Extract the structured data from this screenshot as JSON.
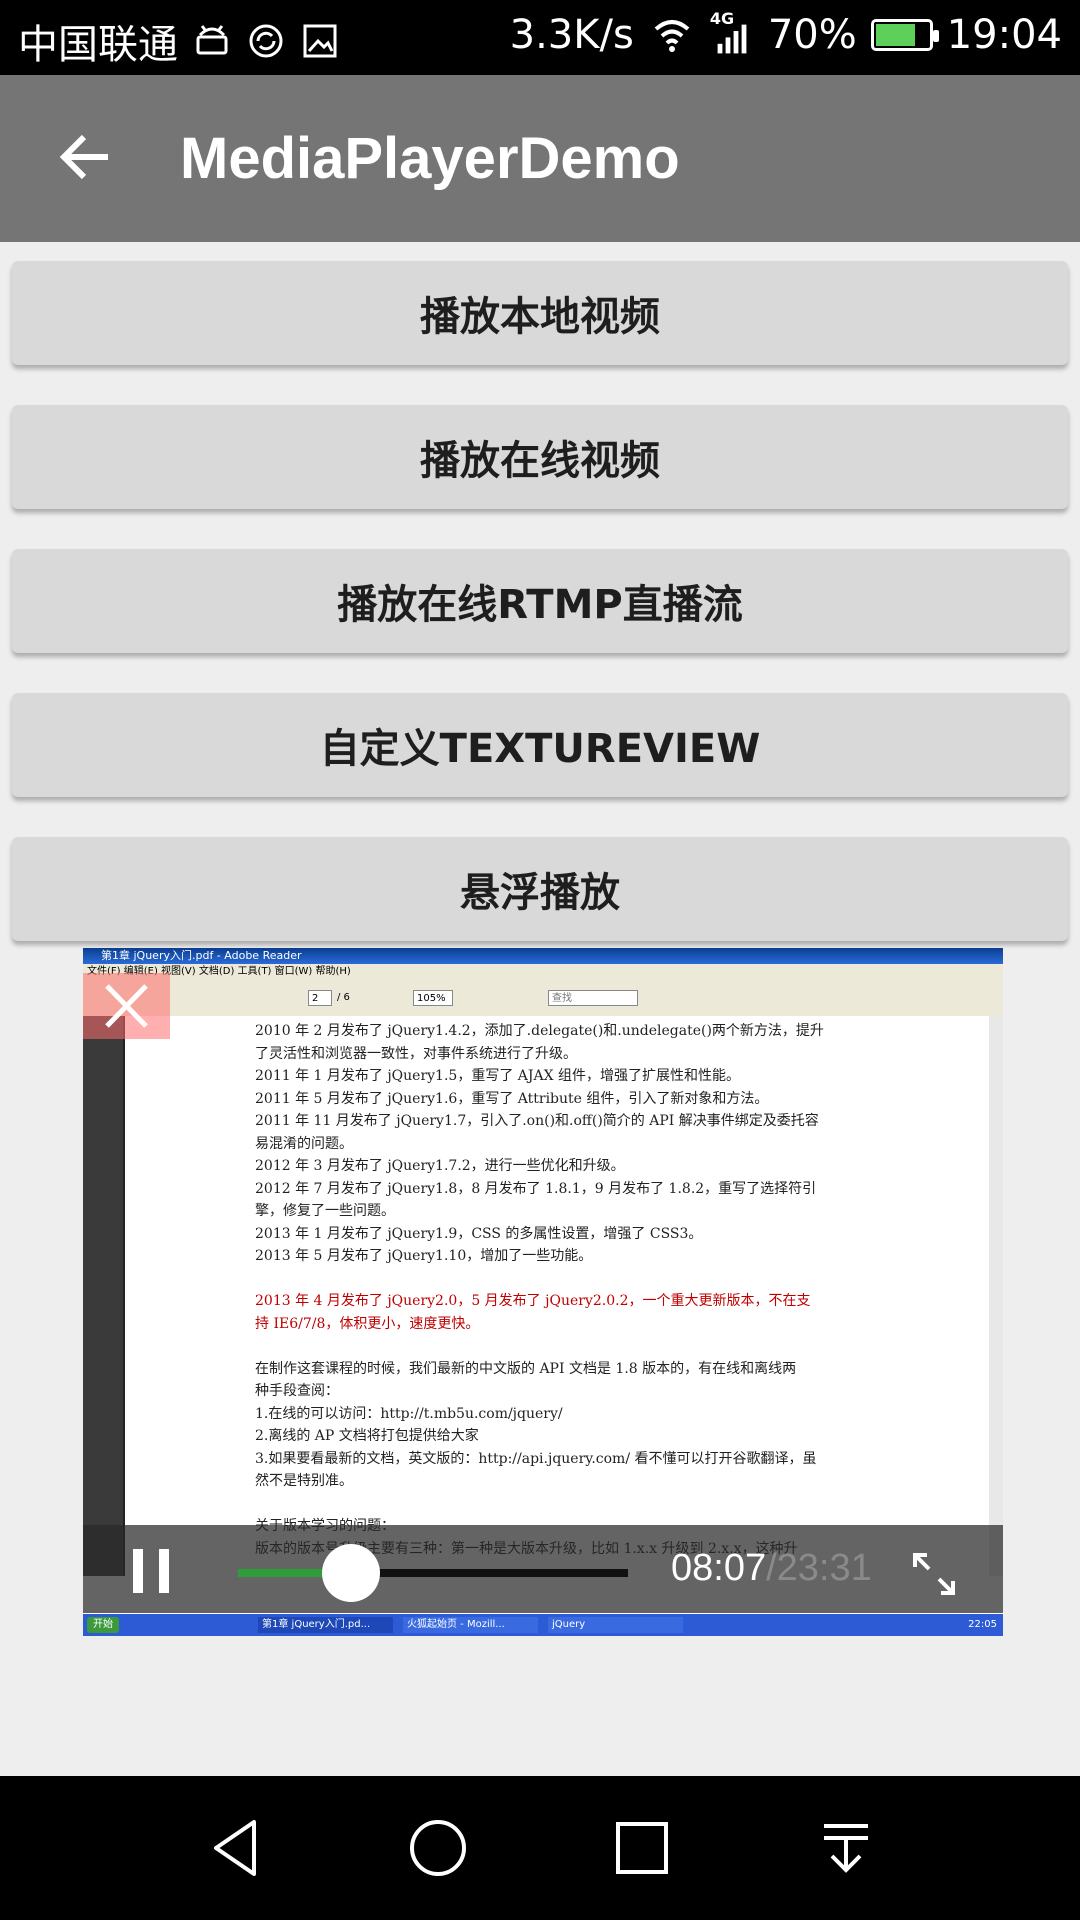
{
  "status_bar": {
    "carrier": "中国联通",
    "network_speed": "3.3K/s",
    "network_type": "4G",
    "battery": "70%",
    "battery_level": 0.7,
    "time": "19:04",
    "icons": [
      "android-icon",
      "sync-icon",
      "image-icon",
      "wifi-icon",
      "signal-icon",
      "battery-icon"
    ]
  },
  "app_bar": {
    "title": "MediaPlayerDemo",
    "back_icon": "arrow-back-icon"
  },
  "buttons": [
    {
      "label": "播放本地视频"
    },
    {
      "label": "播放在线视频"
    },
    {
      "label": "播放在线RTMP直播流"
    },
    {
      "label": "自定义TEXTUREVIEW"
    },
    {
      "label": "悬浮播放"
    }
  ],
  "floating_video": {
    "frame": {
      "window_title": "第1章 jQuery入门.pdf - Adobe Reader",
      "menu": "文件(F)  编辑(E)  视图(V)  文档(D)  工具(T)  窗口(W)  帮助(H)",
      "page_field": "2",
      "page_total": "/ 6",
      "zoom": "105%",
      "search_placeholder": "查找",
      "lines": [
        {
          "text": "2010 年 2 月发布了 jQuery1.4.2，添加了.delegate()和.undelegate()两个新方法，提升",
          "style": ""
        },
        {
          "text": "了灵活性和浏览器一致性，对事件系统进行了升级。",
          "style": ""
        },
        {
          "text": "2011 年 1 月发布了 jQuery1.5，重写了 AJAX 组件，增强了扩展性和性能。",
          "style": ""
        },
        {
          "text": "2011 年 5 月发布了 jQuery1.6，重写了 Attribute 组件，引入了新对象和方法。",
          "style": ""
        },
        {
          "text": "2011 年 11 月发布了 jQuery1.7，引入了.on()和.off()简介的 API 解决事件绑定及委托容",
          "style": ""
        },
        {
          "text": "易混淆的问题。",
          "style": ""
        },
        {
          "text": "2012 年 3 月发布了 jQuery1.7.2，进行一些优化和升级。",
          "style": ""
        },
        {
          "text": "2012 年 7 月发布了 jQuery1.8，8 月发布了 1.8.1，9 月发布了 1.8.2，重写了选择符引",
          "style": ""
        },
        {
          "text": "擎，修复了一些问题。",
          "style": ""
        },
        {
          "text": "2013 年 1 月发布了 jQuery1.9，CSS 的多属性设置，增强了 CSS3。",
          "style": ""
        },
        {
          "text": "2013 年 5 月发布了 jQuery1.10，增加了一些功能。",
          "style": ""
        },
        {
          "text": "",
          "style": ""
        },
        {
          "text": "2013 年 4 月发布了 jQuery2.0，5 月发布了 jQuery2.0.2，一个重大更新版本，不在支",
          "style": "red"
        },
        {
          "text": "持 IE6/7/8，体积更小，速度更快。",
          "style": "red"
        },
        {
          "text": "",
          "style": ""
        },
        {
          "text": "在制作这套课程的时候，我们最新的中文版的 API 文档是 1.8 版本的，有在线和离线两",
          "style": ""
        },
        {
          "text": "种手段查阅：",
          "style": ""
        },
        {
          "text": "1.在线的可以访问：http://t.mb5u.com/jquery/",
          "style": ""
        },
        {
          "text": "2.离线的 AP 文档将打包提供给大家",
          "style": ""
        },
        {
          "text": "3.如果要看最新的文档，英文版的：http://api.jquery.com/ 看不懂可以打开谷歌翻译，虽",
          "style": ""
        },
        {
          "text": "然不是特别准。",
          "style": ""
        },
        {
          "text": "",
          "style": ""
        },
        {
          "text": "关于版本学习的问题：",
          "style": ""
        },
        {
          "text": "版本的版本号升级主要有三种：第一种是大版本升级，比如 1.x.x 升级到 2.x.x，这种升",
          "style": ""
        }
      ],
      "taskbar_start": "开始",
      "taskbar_items": [
        "第1章 jQuery入门.pd...",
        "火狐起始页 - Mozill...",
        "jQuery"
      ],
      "taskbar_clock": "22:05"
    },
    "close_icon": "close-icon",
    "controls": {
      "pause_icon": "pause-icon",
      "current_time": "08:07",
      "total_time": "/23:31",
      "progress": 0.29,
      "buffered": 0.35,
      "fullscreen_icon": "fullscreen-icon"
    }
  },
  "nav_bar": {
    "icons": [
      "nav-back-icon",
      "nav-home-icon",
      "nav-recents-icon",
      "nav-notification-pulldown-icon"
    ]
  }
}
